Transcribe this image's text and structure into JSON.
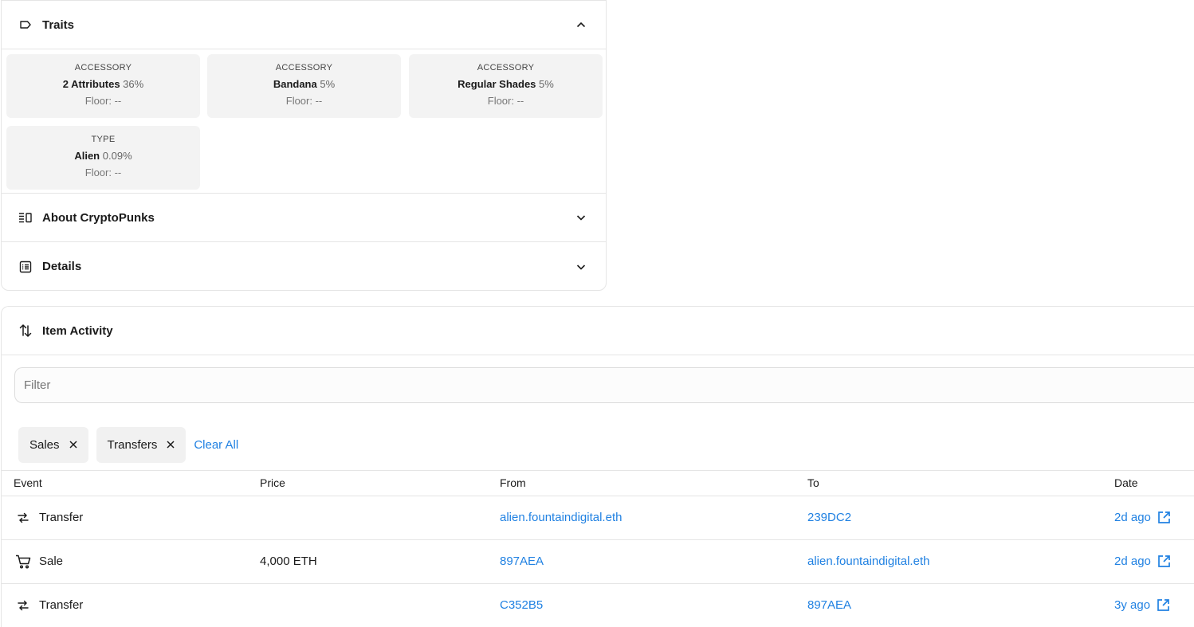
{
  "traits_section": {
    "title": "Traits",
    "items": [
      {
        "type": "ACCESSORY",
        "value": "2 Attributes",
        "percent": "36%",
        "floor": "Floor: --"
      },
      {
        "type": "ACCESSORY",
        "value": "Bandana",
        "percent": "5%",
        "floor": "Floor: --"
      },
      {
        "type": "ACCESSORY",
        "value": "Regular Shades",
        "percent": "5%",
        "floor": "Floor: --"
      },
      {
        "type": "TYPE",
        "value": "Alien",
        "percent": "0.09%",
        "floor": "Floor: --"
      }
    ]
  },
  "about_section": {
    "title": "About CryptoPunks"
  },
  "details_section": {
    "title": "Details"
  },
  "activity": {
    "title": "Item Activity",
    "filter_placeholder": "Filter",
    "chips": [
      "Sales",
      "Transfers"
    ],
    "clear_all": "Clear All",
    "columns": [
      "Event",
      "Price",
      "From",
      "To",
      "Date"
    ],
    "rows": [
      {
        "event": "Transfer",
        "event_icon": "transfer-icon",
        "price": "",
        "from": "alien.fountaindigital.eth",
        "to": "239DC2",
        "date": "2d ago"
      },
      {
        "event": "Sale",
        "event_icon": "cart-icon",
        "price": "4,000 ETH",
        "from": "897AEA",
        "to": "alien.fountaindigital.eth",
        "date": "2d ago"
      },
      {
        "event": "Transfer",
        "event_icon": "transfer-icon",
        "price": "",
        "from": "C352B5",
        "to": "897AEA",
        "date": "3y ago"
      }
    ]
  },
  "colors": {
    "link": "#2081e2",
    "border": "#e5e5e5",
    "trait_bg": "#f3f3f3"
  }
}
